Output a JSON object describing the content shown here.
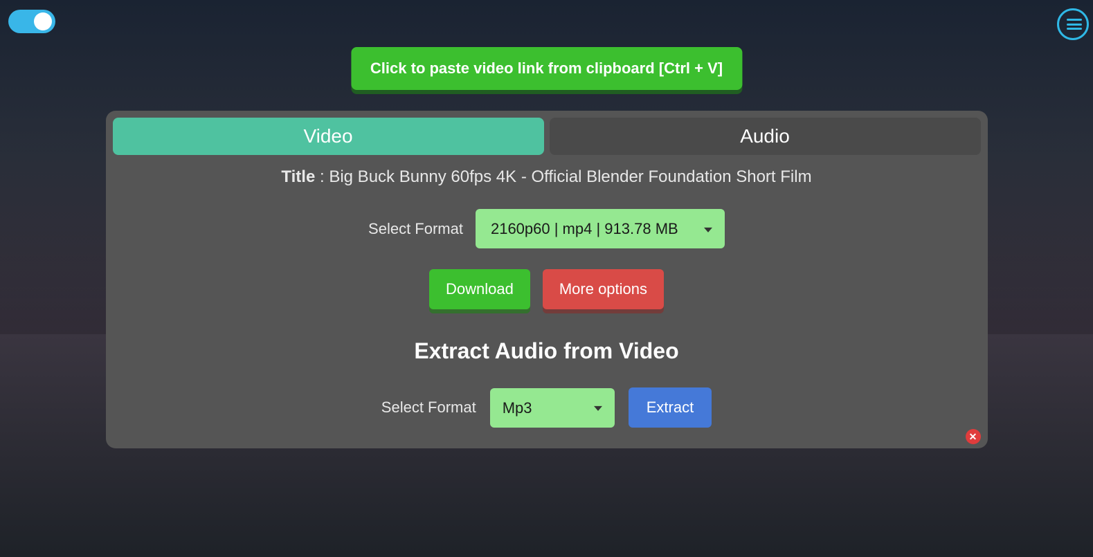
{
  "topbar": {
    "toggle_state": "on",
    "paste_label": "Click to paste video link from clipboard [Ctrl + V]"
  },
  "tabs": {
    "video": "Video",
    "audio": "Audio",
    "active": "video"
  },
  "video": {
    "title_label": "Title",
    "title_separator": " : ",
    "title_value": "Big Buck Bunny 60fps 4K - Official Blender Foundation Short Film",
    "format_label": "Select Format",
    "format_selected": "2160p60 | mp4 | 913.78 MB",
    "download_label": "Download",
    "more_options_label": "More options"
  },
  "extract": {
    "heading": "Extract Audio from Video",
    "format_label": "Select Format",
    "format_selected": "Mp3",
    "extract_label": "Extract"
  },
  "close_icon_glyph": "✕"
}
